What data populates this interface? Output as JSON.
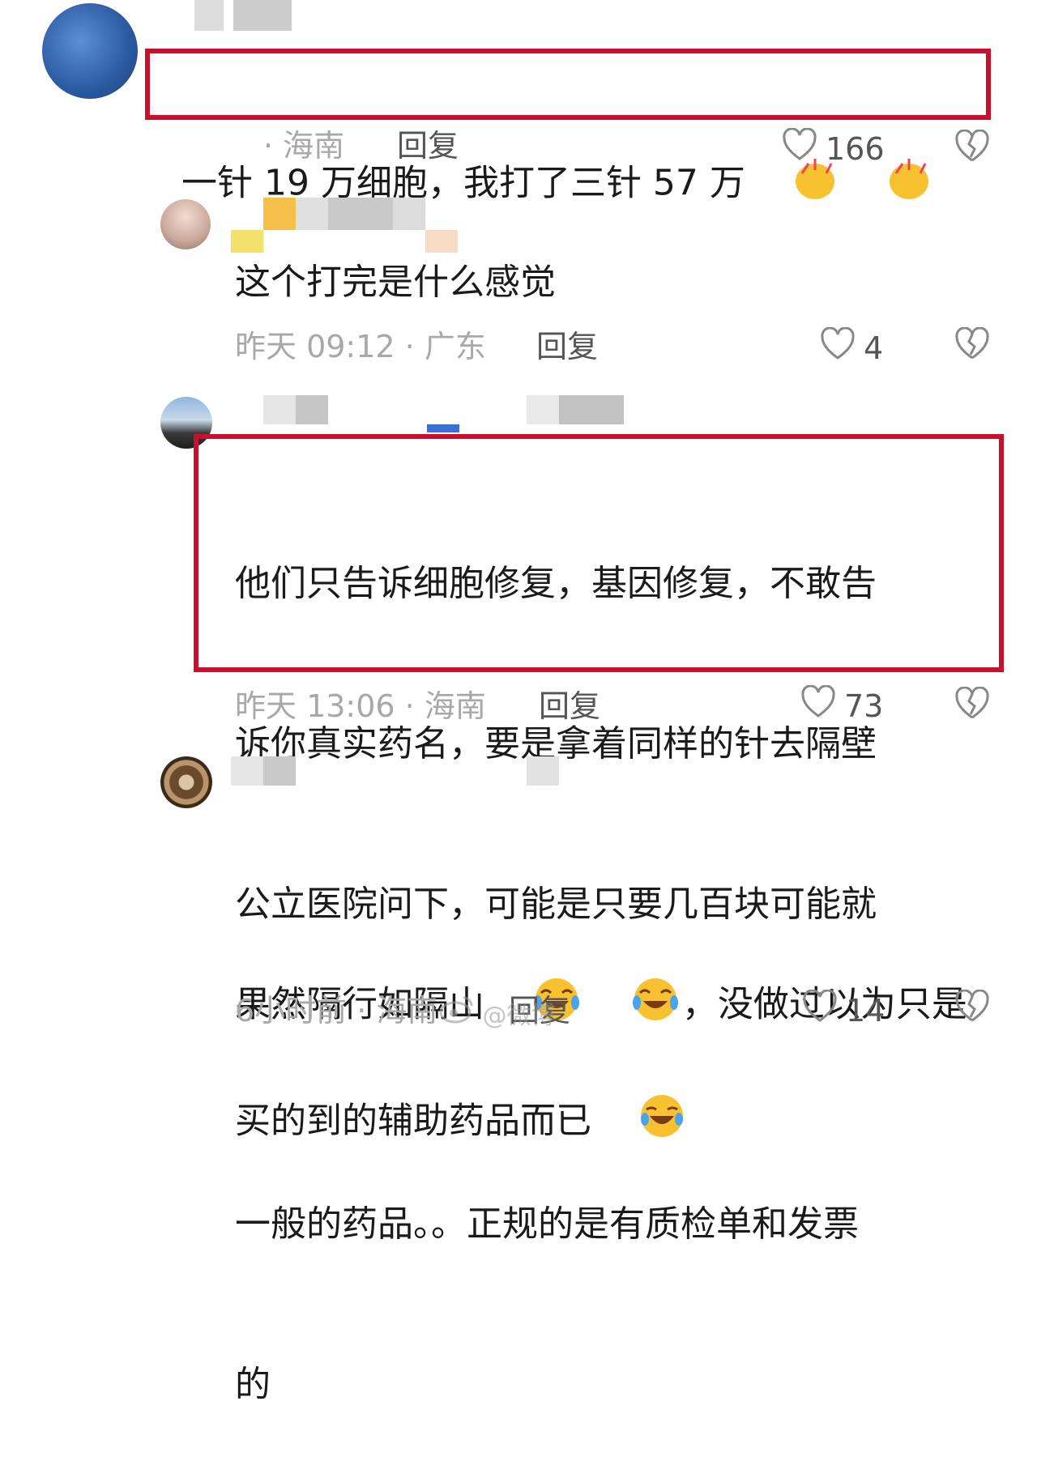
{
  "comments": [
    {
      "text": "一针 19 万细胞，我打了三针 57 万",
      "emoji": [
        "clap-hands",
        "clap-hands"
      ],
      "meta": "· 海南",
      "reply": "回复",
      "likes": "166"
    },
    {
      "text": "这个打完是什么感觉",
      "meta": "昨天 09:12 · 广东",
      "reply": "回复",
      "likes": "4"
    },
    {
      "lines": [
        "他们只告诉细胞修复，基因修复，不敢告",
        "诉你真实药名，要是拿着同样的针去隔壁",
        "公立医院问下，可能是只要几百块可能就",
        "买的到的辅助药品而已"
      ],
      "emoji": [
        "rolling-laughing"
      ],
      "meta": "昨天 13:06 · 海南",
      "reply": "回复",
      "likes": "73"
    },
    {
      "line1_a": "果然隔行如隔山",
      "line1_b": "，没做过以为只是",
      "line2": "一般的药品。。正规的是有质检单和发票",
      "line3": "的",
      "emoji": [
        "tears-of-joy",
        "tears-of-joy"
      ],
      "meta": "6小时前 · 海南",
      "reply": "回复",
      "likes": "14"
    }
  ],
  "watermark": "@微博",
  "colors": {
    "highlight_border": "#c8102e"
  }
}
